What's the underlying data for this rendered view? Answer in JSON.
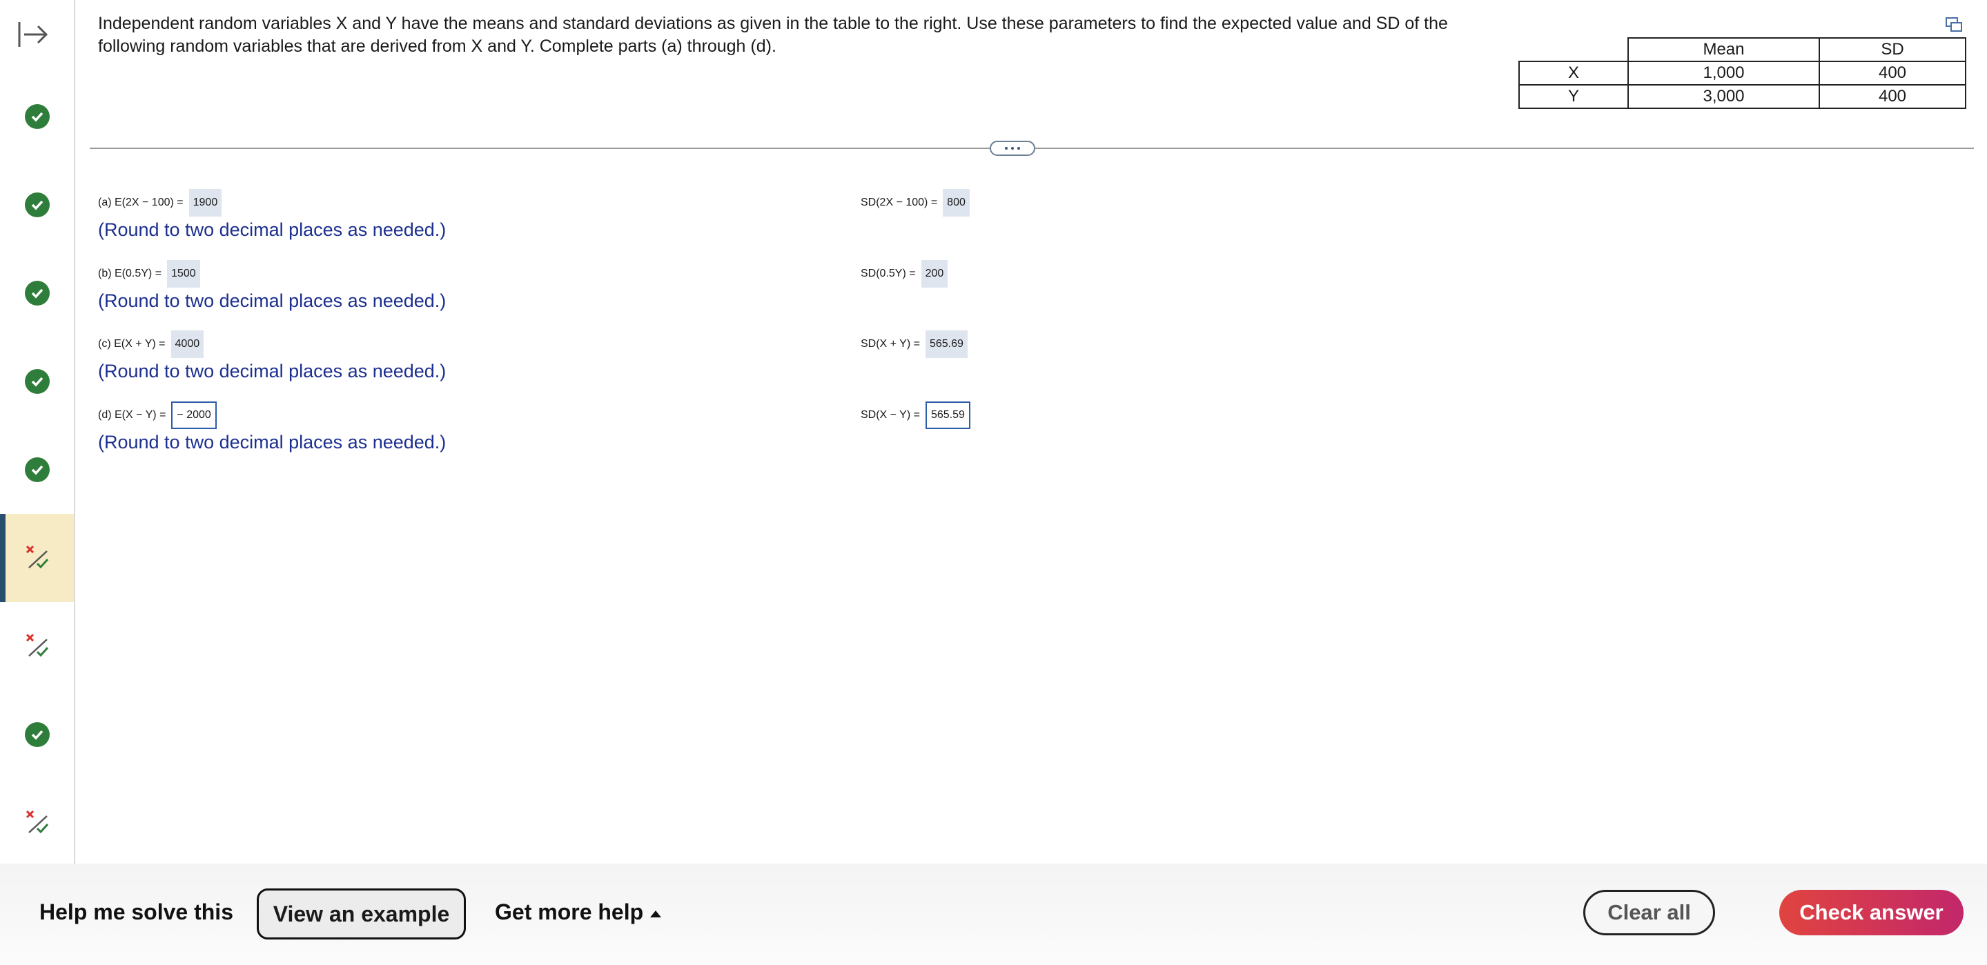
{
  "sidebar": {
    "items": [
      {
        "status": "correct",
        "icon": "check-circle-icon"
      },
      {
        "status": "correct",
        "icon": "check-circle-icon"
      },
      {
        "status": "correct",
        "icon": "check-circle-icon"
      },
      {
        "status": "correct",
        "icon": "check-circle-icon"
      },
      {
        "status": "correct",
        "icon": "check-circle-icon"
      },
      {
        "status": "partial",
        "icon": "partial-credit-icon",
        "active": true
      },
      {
        "status": "partial",
        "icon": "partial-credit-icon"
      },
      {
        "status": "correct",
        "icon": "check-circle-icon"
      },
      {
        "status": "partial",
        "icon": "partial-credit-icon"
      }
    ]
  },
  "question": {
    "text": "Independent random variables X and Y have the means and standard deviations as given in the table to the right. Use these parameters to find the expected value and SD of the following random variables that are derived from X and Y. Complete parts (a) through (d)."
  },
  "table": {
    "headers": [
      "Mean",
      "SD"
    ],
    "rows": [
      {
        "label": "X",
        "mean": "1,000",
        "sd": "400"
      },
      {
        "label": "Y",
        "mean": "3,000",
        "sd": "400"
      }
    ]
  },
  "parts": [
    {
      "e_label": "(a) E(2X − 100) =",
      "e_value": "1900",
      "sd_label": "SD(2X − 100) =",
      "sd_value": "800",
      "hint": "(Round to two decimal places as needed.)"
    },
    {
      "e_label": "(b) E(0.5Y) =",
      "e_value": "1500",
      "sd_label": "SD(0.5Y) =",
      "sd_value": "200",
      "hint": "(Round to two decimal places as needed.)"
    },
    {
      "e_label": "(c) E(X + Y) =",
      "e_value": "4000",
      "sd_label": "SD(X + Y) =",
      "sd_value": "565.69",
      "hint": "(Round to two decimal places as needed.)"
    },
    {
      "e_label": "(d) E(X − Y) =",
      "e_value": "− 2000",
      "sd_label": "SD(X − Y) =",
      "sd_value": "565.59",
      "hint": "(Round to two decimal places as needed.)"
    }
  ],
  "footer": {
    "help_me_solve": "Help me solve this",
    "view_example": "View an example",
    "get_more_help": "Get more help",
    "clear_all": "Clear all",
    "check_answer": "Check answer"
  },
  "colors": {
    "correct_green": "#2f7d3a",
    "hint_blue": "#1c2f8f",
    "active_row": "#f7ebc5",
    "check_answer_gradient": [
      "#e0443f",
      "#c2276b"
    ]
  }
}
